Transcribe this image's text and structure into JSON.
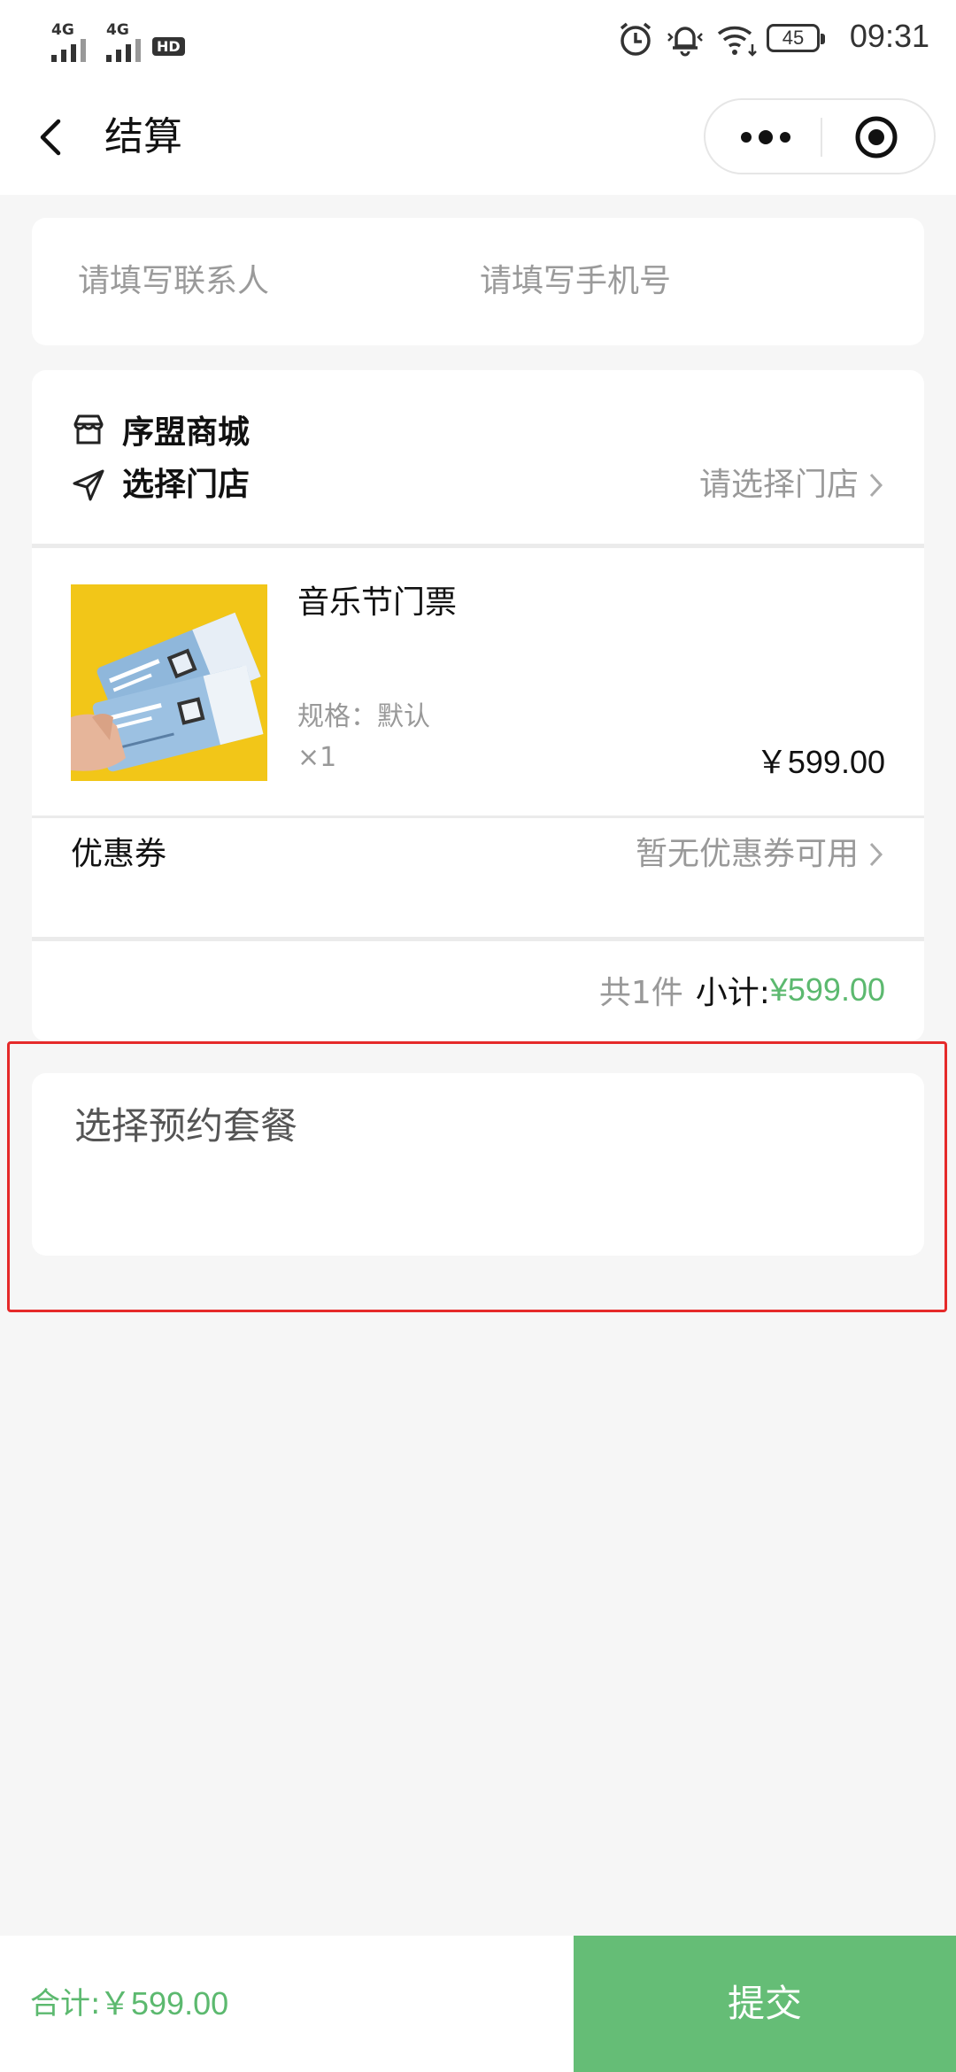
{
  "status_bar": {
    "network_1": "4G",
    "network_2": "4G",
    "hd_badge": "HD",
    "battery": "45",
    "time": "09:31"
  },
  "nav": {
    "title": "结算"
  },
  "contact": {
    "name_placeholder": "请填写联系人",
    "phone_placeholder": "请填写手机号"
  },
  "shop": {
    "name": "序盟商城",
    "store_label": "选择门店",
    "store_select": "请选择门店"
  },
  "product": {
    "name": "音乐节门票",
    "spec": "规格：默认",
    "qty": "×1",
    "price": "￥599.00",
    "image_icon": "ticket-photo"
  },
  "coupon": {
    "label": "优惠券",
    "value": "暂无优惠券可用"
  },
  "subtotal": {
    "count": "共1件",
    "label": "小计:",
    "value": "¥599.00"
  },
  "package": {
    "title": "选择预约套餐"
  },
  "bottom": {
    "total_label": "合计:",
    "total_value": "￥599.00",
    "submit": "提交"
  },
  "colors": {
    "accent_green": "#5cb96f",
    "submit_green": "#65bd76",
    "highlight_red": "#e52a2a",
    "background": "#f6f6f6"
  }
}
